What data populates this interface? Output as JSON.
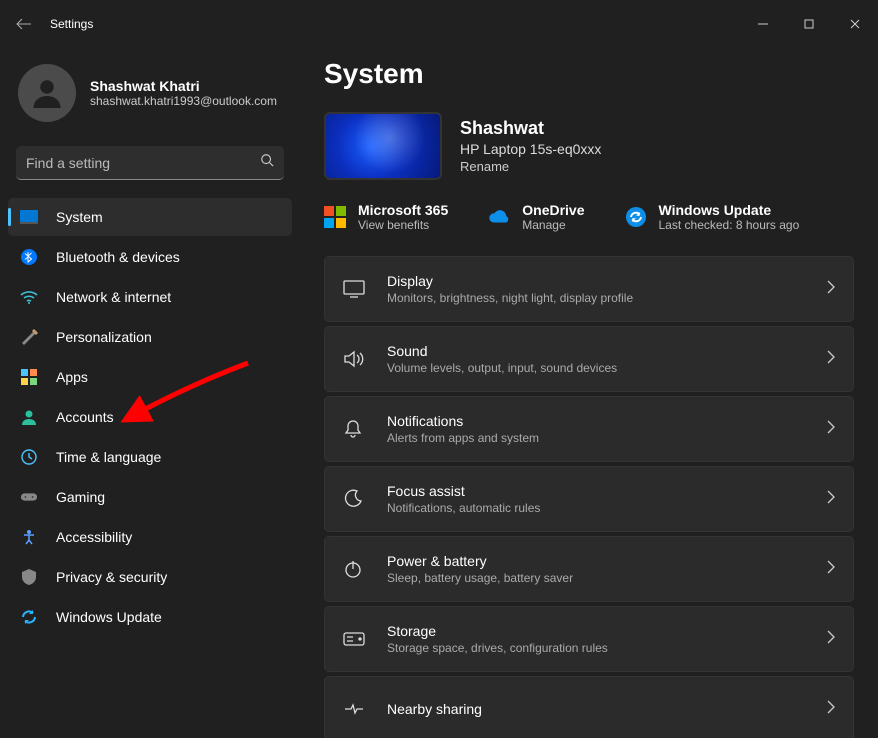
{
  "window": {
    "title": "Settings"
  },
  "profile": {
    "name": "Shashwat Khatri",
    "email": "shashwat.khatri1993@outlook.com"
  },
  "search": {
    "placeholder": "Find a setting"
  },
  "sidebar": {
    "items": [
      {
        "label": "System",
        "icon": "system",
        "active": true
      },
      {
        "label": "Bluetooth & devices",
        "icon": "bluetooth"
      },
      {
        "label": "Network & internet",
        "icon": "network"
      },
      {
        "label": "Personalization",
        "icon": "personalization"
      },
      {
        "label": "Apps",
        "icon": "apps"
      },
      {
        "label": "Accounts",
        "icon": "accounts"
      },
      {
        "label": "Time & language",
        "icon": "time"
      },
      {
        "label": "Gaming",
        "icon": "gaming"
      },
      {
        "label": "Accessibility",
        "icon": "accessibility"
      },
      {
        "label": "Privacy & security",
        "icon": "privacy"
      },
      {
        "label": "Windows Update",
        "icon": "update"
      }
    ]
  },
  "page": {
    "title": "System"
  },
  "hero": {
    "name": "Shashwat",
    "device": "HP Laptop 15s-eq0xxx",
    "rename": "Rename"
  },
  "promos": [
    {
      "title": "Microsoft 365",
      "sub": "View benefits",
      "icon": "m365"
    },
    {
      "title": "OneDrive",
      "sub": "Manage",
      "icon": "onedrive"
    },
    {
      "title": "Windows Update",
      "sub": "Last checked: 8 hours ago",
      "icon": "update"
    }
  ],
  "tiles": [
    {
      "title": "Display",
      "sub": "Monitors, brightness, night light, display profile",
      "icon": "display"
    },
    {
      "title": "Sound",
      "sub": "Volume levels, output, input, sound devices",
      "icon": "sound"
    },
    {
      "title": "Notifications",
      "sub": "Alerts from apps and system",
      "icon": "notifications"
    },
    {
      "title": "Focus assist",
      "sub": "Notifications, automatic rules",
      "icon": "focus"
    },
    {
      "title": "Power & battery",
      "sub": "Sleep, battery usage, battery saver",
      "icon": "power"
    },
    {
      "title": "Storage",
      "sub": "Storage space, drives, configuration rules",
      "icon": "storage"
    },
    {
      "title": "Nearby sharing",
      "sub": "",
      "icon": "nearby"
    }
  ]
}
